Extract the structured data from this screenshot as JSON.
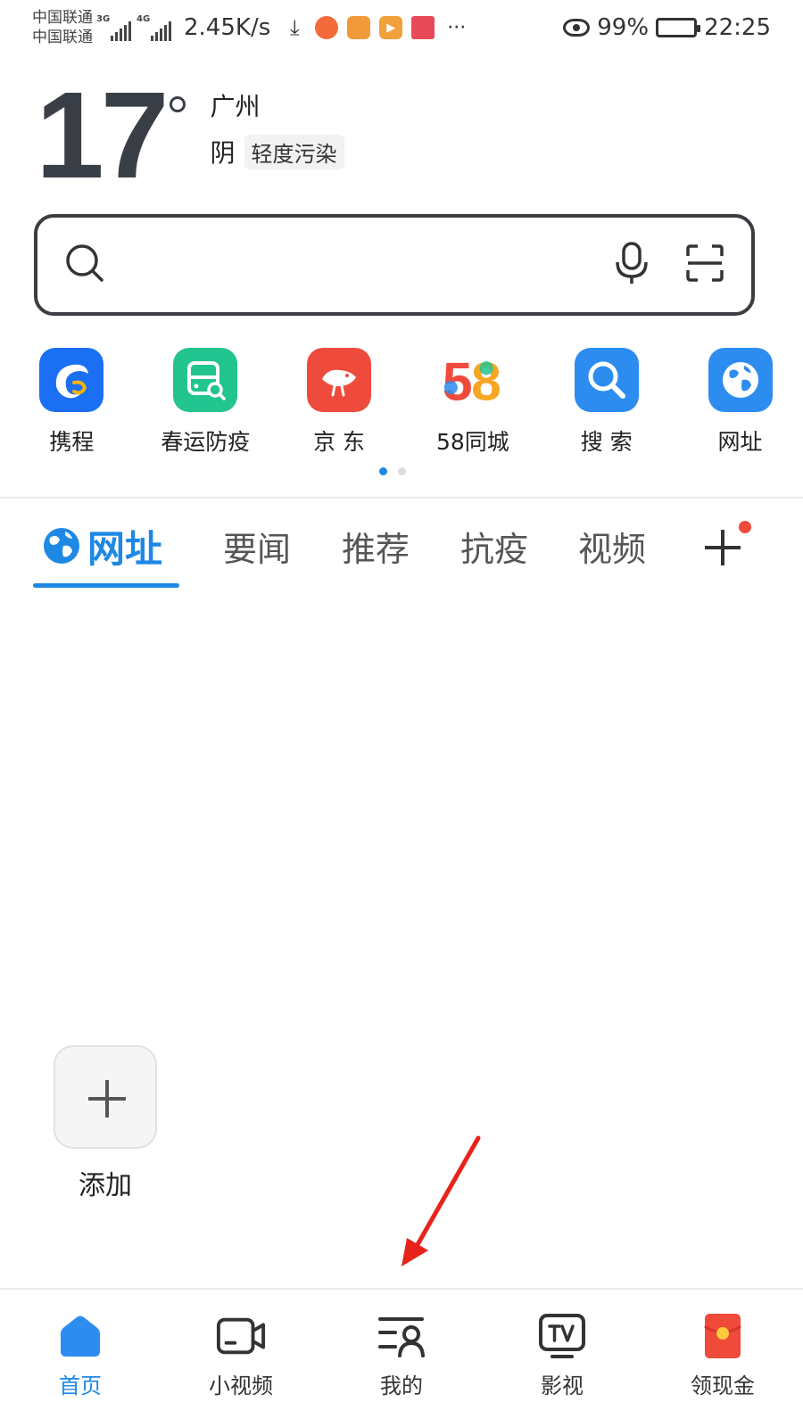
{
  "status_bar": {
    "carrier_1": "中国联通",
    "carrier_2": "中国联通",
    "signal_1_tag": "3G",
    "signal_2_tag": "4G",
    "net_speed": "2.45K/s",
    "battery": "99%",
    "time": "22:25",
    "more": "···"
  },
  "weather": {
    "temperature": "17",
    "city": "广州",
    "condition": "阴",
    "air_quality": "轻度污染"
  },
  "search": {
    "placeholder": "",
    "icons": [
      "search-icon",
      "microphone-icon",
      "scan-icon"
    ]
  },
  "quick_links": [
    {
      "label": "携程",
      "icon": "ctrip-dolphin-icon",
      "color": "#1a6ff2"
    },
    {
      "label": "春运防疫",
      "icon": "bus-search-icon",
      "color": "#22c48f"
    },
    {
      "label": "京 东",
      "icon": "jd-dog-icon",
      "color": "#ef4b3c"
    },
    {
      "label": "58同城",
      "icon": "58-logo",
      "color": "#ffffff"
    },
    {
      "label": "搜 索",
      "icon": "magnifier-icon",
      "color": "#2d8cf0"
    },
    {
      "label": "网址",
      "icon": "globe-icon",
      "color": "#2d8cf0"
    }
  ],
  "pager": {
    "active_color": "#1e88e5",
    "inactive_color": "#dddddd"
  },
  "tabs": [
    {
      "label": "网址",
      "active": true
    },
    {
      "label": "要闻",
      "active": false
    },
    {
      "label": "推荐",
      "active": false
    },
    {
      "label": "抗疫",
      "active": false
    },
    {
      "label": "视频",
      "active": false
    }
  ],
  "add_tile": {
    "label": "添加"
  },
  "bottom_nav": [
    {
      "label": "首页",
      "icon": "home-icon",
      "active": true
    },
    {
      "label": "小视频",
      "icon": "video-camera-icon",
      "active": false
    },
    {
      "label": "我的",
      "icon": "profile-list-icon",
      "active": false
    },
    {
      "label": "影视",
      "icon": "tv-icon",
      "active": false
    },
    {
      "label": "领现金",
      "icon": "red-envelope-icon",
      "active": false
    }
  ],
  "colors": {
    "accent": "#1e88e5",
    "arrow": "#e8231c",
    "badge": "#f04a3a"
  }
}
